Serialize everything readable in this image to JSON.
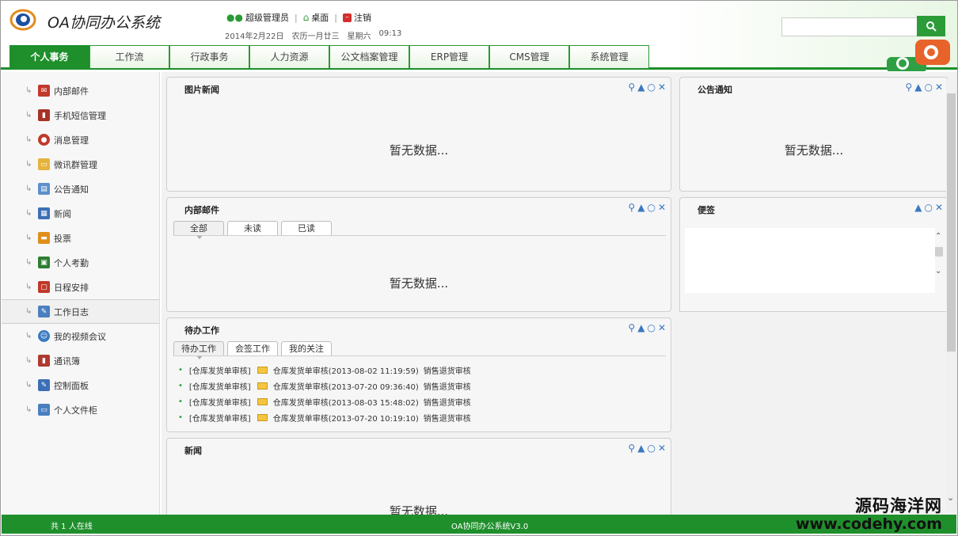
{
  "app": {
    "title": "OA协同办公系统",
    "version_text": "OA协同办公系统V3.0",
    "online_text": "共 1 人在线"
  },
  "userbar": {
    "user": "超级管理员",
    "desktop": "桌面",
    "logout": "注销",
    "date": "2014年2月22日",
    "lunar": "农历一月廿三",
    "weekday": "星期六",
    "time": "09:13"
  },
  "search": {
    "value": "",
    "placeholder": ""
  },
  "tabs": [
    {
      "label": "个人事务",
      "active": true
    },
    {
      "label": "工作流"
    },
    {
      "label": "行政事务"
    },
    {
      "label": "人力资源"
    },
    {
      "label": "公文档案管理"
    },
    {
      "label": "ERP管理"
    },
    {
      "label": "CMS管理"
    },
    {
      "label": "系统管理"
    }
  ],
  "sidebar": {
    "items": [
      {
        "label": "内部邮件",
        "icon": "mail-icon",
        "color": "#c0392b"
      },
      {
        "label": "手机短信管理",
        "icon": "phone-icon",
        "color": "#a93226"
      },
      {
        "label": "消息管理",
        "icon": "message-icon",
        "color": "#c0392b"
      },
      {
        "label": "微讯群管理",
        "icon": "folder-icon",
        "color": "#e6b33e"
      },
      {
        "label": "公告通知",
        "icon": "notice-icon",
        "color": "#5d8fc9"
      },
      {
        "label": "新闻",
        "icon": "news-icon",
        "color": "#3c6fb5"
      },
      {
        "label": "投票",
        "icon": "vote-icon",
        "color": "#e08e1b"
      },
      {
        "label": "个人考勤",
        "icon": "attendance-icon",
        "color": "#2e7d32"
      },
      {
        "label": "日程安排",
        "icon": "calendar-icon",
        "color": "#c0392b"
      },
      {
        "label": "工作日志",
        "icon": "log-icon",
        "color": "#4a7fc0",
        "selected": true
      },
      {
        "label": "我的视频会议",
        "icon": "video-meeting-icon",
        "color": "#3a79c2"
      },
      {
        "label": "通讯簿",
        "icon": "address-book-icon",
        "color": "#b03a2e"
      },
      {
        "label": "控制面板",
        "icon": "control-panel-icon",
        "color": "#3c6fb5"
      },
      {
        "label": "个人文件柜",
        "icon": "file-cabinet-icon",
        "color": "#4a7fc0"
      }
    ]
  },
  "panels": {
    "picture_news": {
      "title": "图片新闻",
      "nodata": "暂无数据..."
    },
    "notice": {
      "title": "公告通知",
      "nodata": "暂无数据..."
    },
    "mail": {
      "title": "内部邮件",
      "tabs": [
        "全部",
        "未读",
        "已读"
      ],
      "nodata": "暂无数据..."
    },
    "memo": {
      "title": "便签"
    },
    "todo": {
      "title": "待办工作",
      "tabs": [
        "待办工作",
        "会签工作",
        "我的关注"
      ],
      "rows": [
        {
          "category": "[仓库发货单审核]",
          "text": "仓库发货单审核(2013-08-02 11:19:59)",
          "step": "销售退货审核"
        },
        {
          "category": "[仓库发货单审核]",
          "text": "仓库发货单审核(2013-07-20 09:36:40)",
          "step": "销售退货审核"
        },
        {
          "category": "[仓库发货单审核]",
          "text": "仓库发货单审核(2013-08-03 15:48:02)",
          "step": "销售退货审核"
        },
        {
          "category": "[仓库发货单审核]",
          "text": "仓库发货单审核(2013-07-20 10:19:10)",
          "step": "销售退货审核"
        }
      ]
    },
    "news": {
      "title": "新闻",
      "nodata": "暂无数据..."
    }
  },
  "watermark": {
    "line1": "源码海洋网",
    "line2": "www.codehy.com"
  },
  "colors": {
    "brand_green": "#1e8f2b",
    "tool_blue": "#3a79c2"
  }
}
